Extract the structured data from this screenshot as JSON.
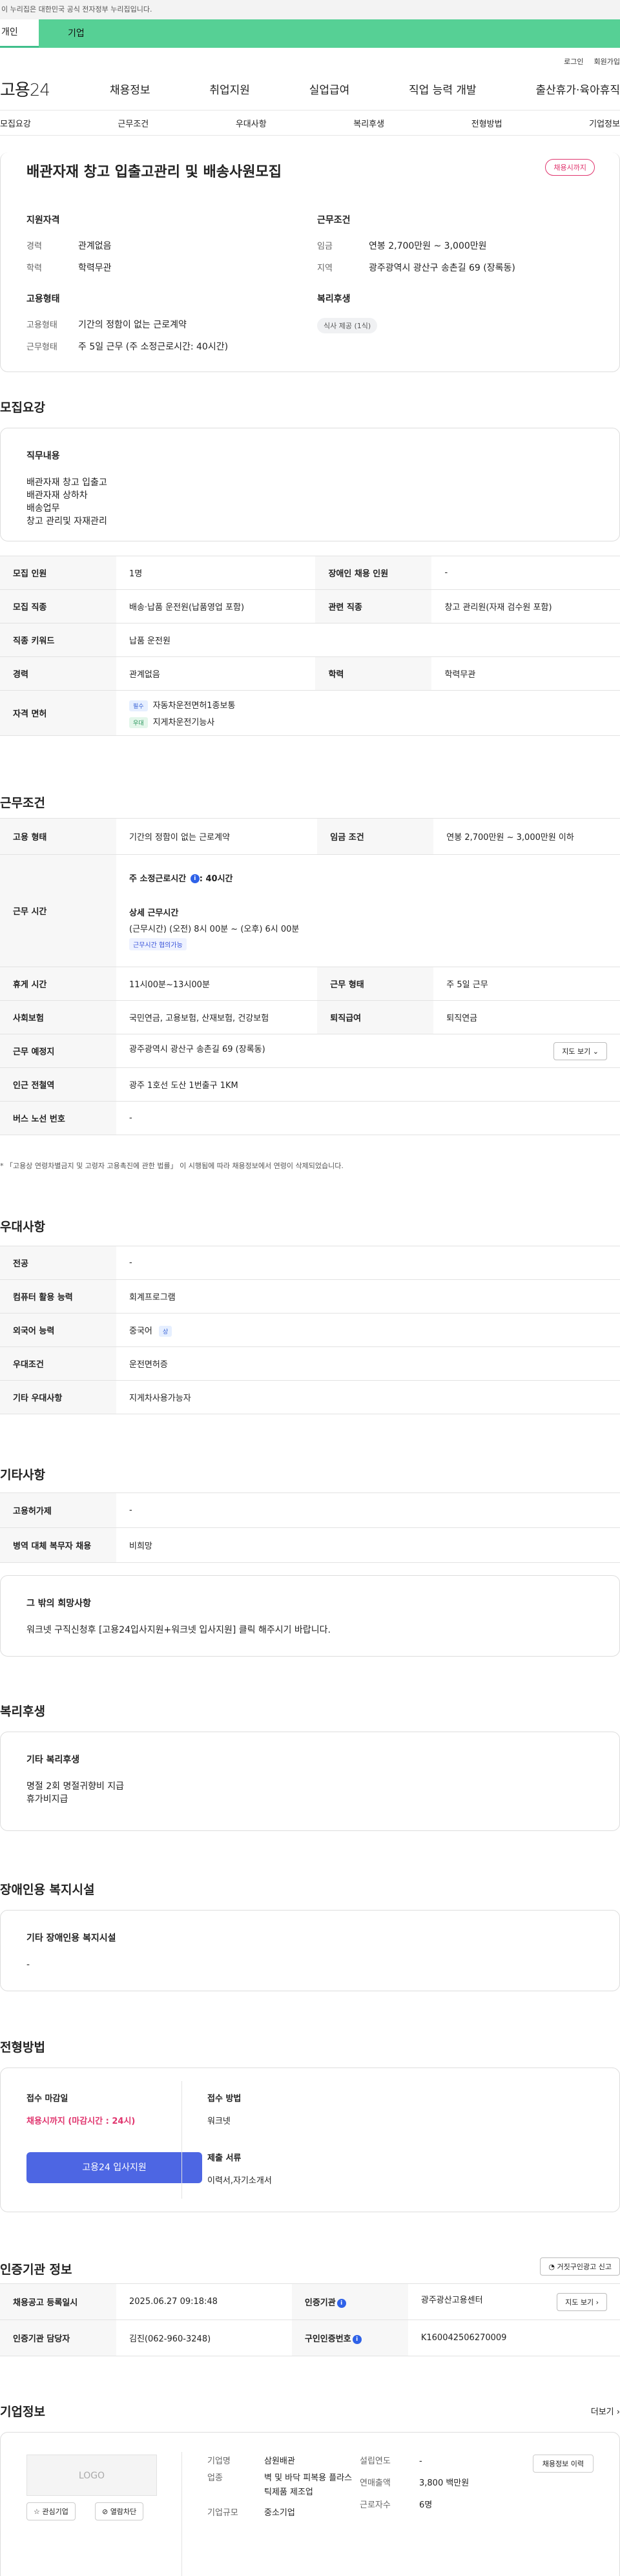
{
  "gov_banner": "이 누리집은 대한민국 공식 전자정부 누리집입니다.",
  "top_tabs": {
    "individual": "개인",
    "company": "기업"
  },
  "util_links": {
    "login": "로그인",
    "signup": "회원가입"
  },
  "logo": "고용24",
  "gnb": [
    "채용정보",
    "취업지원",
    "실업급여",
    "직업 능력 개발",
    "출산휴가·육아휴직"
  ],
  "subnav": [
    "모집요강",
    "근무조건",
    "우대사항",
    "복리후생",
    "전형방법",
    "기업정보"
  ],
  "summary": {
    "title": "배관자재 창고 입출고관리 및 배송사원모집",
    "badge": "채용시까지",
    "qual": {
      "heading": "지원자격",
      "rows": [
        {
          "k": "경력",
          "v": "관계없음"
        },
        {
          "k": "학력",
          "v": "학력무관"
        }
      ]
    },
    "work": {
      "heading": "근무조건",
      "rows": [
        {
          "k": "임금",
          "v": "연봉 2,700만원 ~ 3,000만원"
        },
        {
          "k": "지역",
          "v": "광주광역시 광산구 송촌길 69 (장록동)"
        }
      ]
    },
    "emp": {
      "heading": "고용형태",
      "rows": [
        {
          "k": "고용형태",
          "v": "기간의 정함이 없는 근로계약"
        },
        {
          "k": "근무형태",
          "v": "주 5일 근무 (주 소정근로시간: 40시간)"
        }
      ]
    },
    "welfare": {
      "heading": "복리후생",
      "chip": "식사 제공 (1식)"
    }
  },
  "recruit": {
    "title": "모집요강",
    "duty_heading": "직무내용",
    "duty_lines": [
      "배관자재 창고 입출고",
      "배관자재 상하차",
      "배송업무",
      "창고 관리및 자재관리"
    ],
    "rows": [
      {
        "k1": "모집 인원",
        "v1": "1명",
        "k2": "장애인 채용 인원",
        "v2": "-"
      },
      {
        "k1": "모집 직종",
        "v1": "배송·납품 운전원(납품영업 포함)",
        "k2": "관련 직종",
        "v2": "창고 관리원(자재 검수원 포함)"
      },
      {
        "k1": "직종 키워드",
        "v1": "납품 운전원"
      },
      {
        "k1": "경력",
        "v1": "관계없음",
        "k2": "학력",
        "v2": "학력무관"
      }
    ],
    "license_label": "자격 면허",
    "licenses": [
      {
        "tag": "필수",
        "name": "자동차운전면허1종보통"
      },
      {
        "tag": "우대",
        "name": "지게차운전기능사"
      }
    ]
  },
  "conditions": {
    "title": "근무조건",
    "emp_type_label": "고용 형태",
    "emp_type": "기간의 정함이 없는 근로계약",
    "wage_label": "임금 조건",
    "wage": "연봉 2,700만원 ~ 3,000만원 이하",
    "hours_label": "근무 시간",
    "weekly_hours": "주 소정근로시간 ",
    "weekly_hours_val": ": 40시간",
    "detail_heading": "상세 근무시간",
    "detail": "(근무시간) (오전) 8시 00분 ~ (오후) 6시 00분",
    "flex_tag": "근무시간 협의가능",
    "rest_label": "휴게 시간",
    "rest": "11시00분~13시00분",
    "work_form_label": "근무 형태",
    "work_form": "주 5일 근무",
    "insurance_label": "사회보험",
    "insurance": "국민연금, 고용보험, 산재보험, 건강보험",
    "severance_label": "퇴직급여",
    "severance": "퇴직연금",
    "place_label": "근무 예정지",
    "place": "광주광역시 광산구 송촌길 69 (장록동)",
    "map_btn": "지도 보기",
    "subway_label": "인근 전철역",
    "subway": "광주 1호선 도산 1번출구 1KM",
    "bus_label": "버스 노선 번호",
    "bus": "-",
    "note": "* 「고용상 연령차별금지 및 고령자 고용촉진에 관한 법률」 이 시행됨에 따라 채용정보에서 연령이 삭제되었습니다."
  },
  "preference": {
    "title": "우대사항",
    "rows": [
      {
        "k": "전공",
        "v": "-"
      },
      {
        "k": "컴퓨터 활용 능력",
        "v": "회계프로그램"
      },
      {
        "k": "외국어 능력",
        "v": "중국어",
        "tag": "상"
      },
      {
        "k": "우대조건",
        "v": "운전면허증"
      },
      {
        "k": "기타 우대사항",
        "v": "지게차사용가능자"
      }
    ]
  },
  "etc": {
    "title": "기타사항",
    "rows": [
      {
        "k": "고용허가제",
        "v": "-"
      },
      {
        "k": "병역 대체 복무자 채용",
        "v": "비희망"
      }
    ],
    "other_heading": "그 밖의 희망사항",
    "other_text": "워크넷 구직신청후 [고용24입사지원+워크넷 입사지원] 클릭 해주시기 바랍니다."
  },
  "welfare": {
    "title": "복리후생",
    "heading": "기타 복리후생",
    "lines": [
      "명절 2회 명절귀향비 지급",
      "휴가비지급"
    ]
  },
  "disability": {
    "title": "장애인용 복지시설",
    "heading": "기타 장애인용 복지시설",
    "value": "-"
  },
  "selection": {
    "title": "전형방법",
    "deadline_label": "접수 마감일",
    "deadline": "채용시까지 (마감시간 : 24시)",
    "apply_btn": "고용24 입사지원",
    "method_label": "접수 방법",
    "method": "워크넷",
    "docs_label": "제출 서류",
    "docs": "이력서,자기소개서"
  },
  "agency": {
    "title": "인증기관 정보",
    "report_btn": "거짓구인광고 신고",
    "reg_date_label": "채용공고 등록일시",
    "reg_date": "2025.06.27 09:18:48",
    "agency_label": "인증기관",
    "agency": "광주광산고용센터",
    "map_btn": "지도 보기",
    "manager_label": "인증기관 담당자",
    "manager": "김진(062-960-3248)",
    "auth_no_label": "구인인증번호",
    "auth_no": "K160042506270009"
  },
  "company": {
    "title": "기업정보",
    "more": "더보기",
    "logo_text": "LOGO",
    "fav_btn": "관심기업",
    "block_btn": "열람차단",
    "name_label": "기업명",
    "name": "삼원배관",
    "industry_label": "업종",
    "industry": "벽 및 바닥 피복용 플라스틱제품 제조업",
    "size_label": "기업규모",
    "size": "중소기업",
    "founded_label": "설립연도",
    "founded": "-",
    "sales_label": "연매출액",
    "sales": "3,800 백만원",
    "employees_label": "근로자수",
    "employees": "6명",
    "info_btn": "채용정보 이력"
  }
}
